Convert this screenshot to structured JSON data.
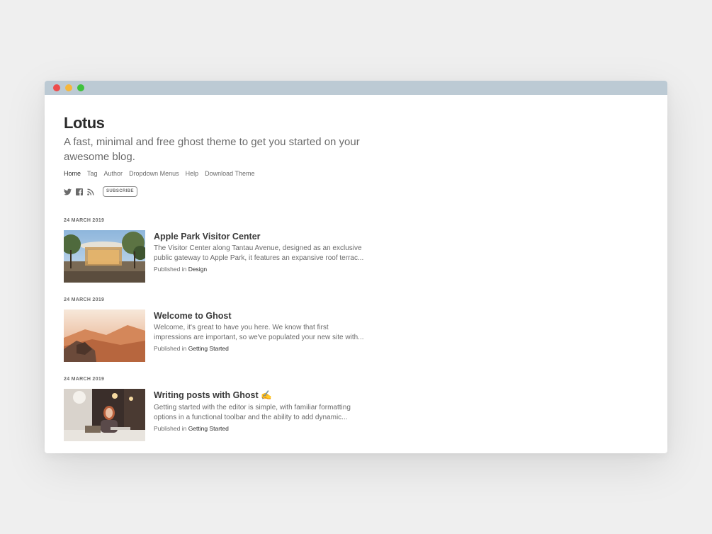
{
  "window": {
    "traffic_lights": {
      "close": "#ed4c4c",
      "minimize": "#f6b73c",
      "maximize": "#3ec23c"
    }
  },
  "site": {
    "title": "Lotus",
    "description": "A fast, minimal and free ghost theme to get you started on your awesome blog."
  },
  "nav": {
    "items": [
      "Home",
      "Tag",
      "Author",
      "Dropdown Menus",
      "Help",
      "Download Theme"
    ],
    "active": "Home"
  },
  "social": {
    "icons": [
      "twitter-icon",
      "facebook-icon",
      "rss-icon"
    ],
    "subscribe_label": "SUBSCRIBE"
  },
  "posts": [
    {
      "date": "24 MARCH 2019",
      "title": "Apple Park Visitor Center",
      "excerpt": "The Visitor Center along Tantau Avenue, designed as an exclusive public gateway to Apple Park, it features an expansive roof terrac...",
      "published_prefix": "Published in",
      "tag": "Design",
      "image": "apple-park-photo"
    },
    {
      "date": "24 MARCH 2019",
      "title": "Welcome to Ghost",
      "excerpt": "Welcome, it's great to have you here. We know that first impressions are important, so we've populated your new site with...",
      "published_prefix": "Published in",
      "tag": "Getting Started",
      "image": "desert-canyon-photo"
    },
    {
      "date": "24 MARCH 2019",
      "title": "Writing posts with Ghost ✍️",
      "excerpt": "Getting started with the editor is simple, with familiar formatting options in a functional toolbar and the ability to add dynamic...",
      "published_prefix": "Published in",
      "tag": "Getting Started",
      "image": "woman-laptop-photo"
    }
  ]
}
